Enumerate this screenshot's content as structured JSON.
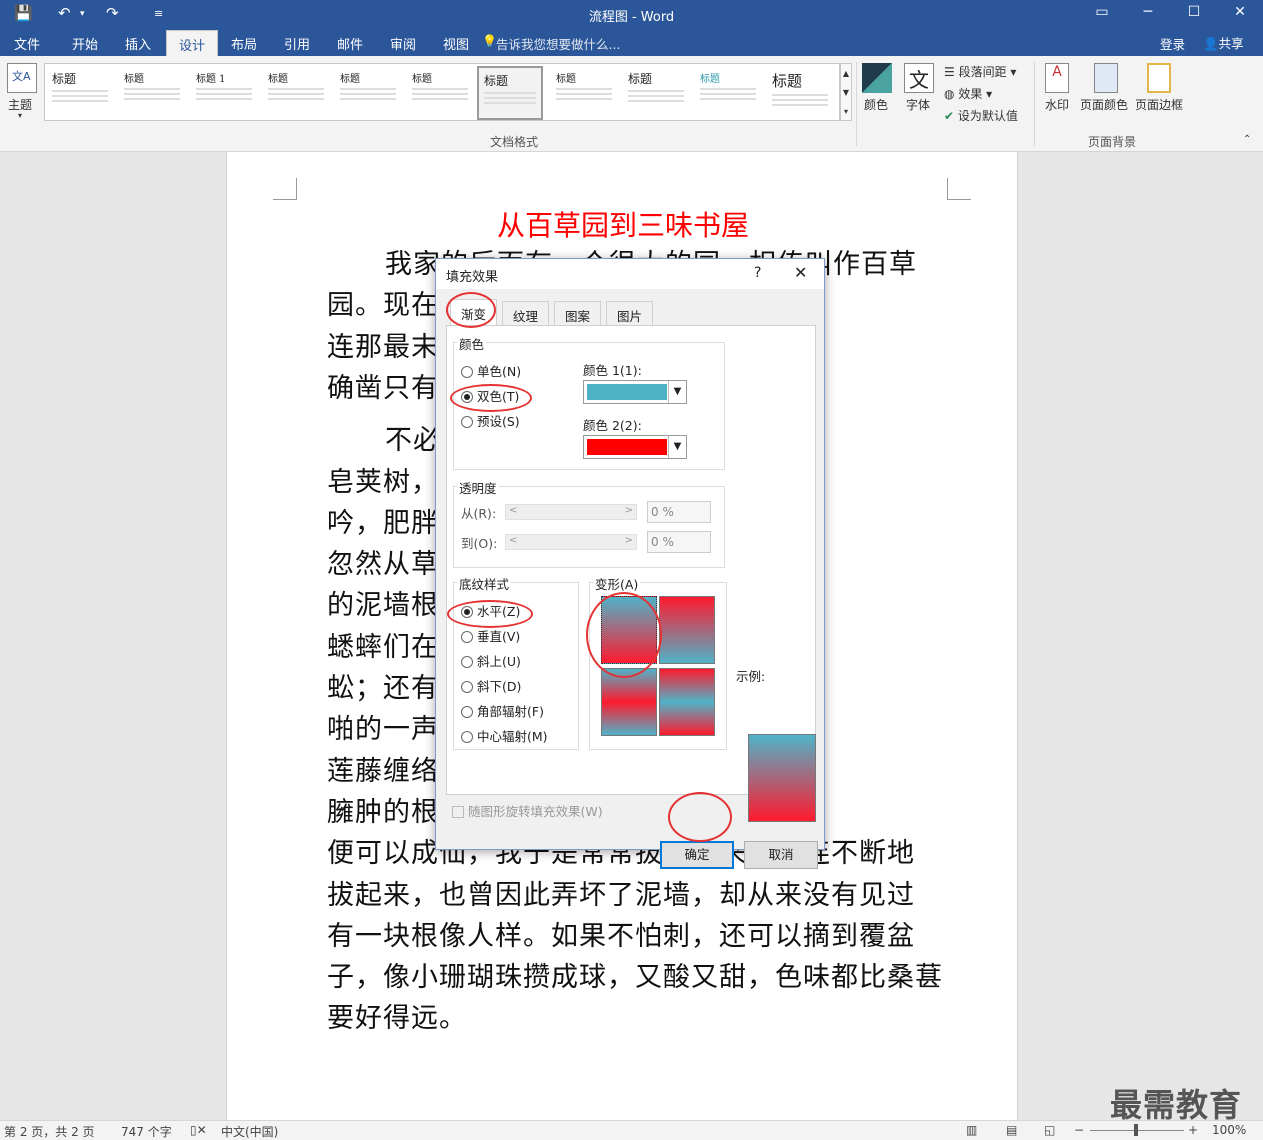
{
  "window": {
    "title": "流程图 - Word"
  },
  "ribbon_tabs": [
    "文件",
    "开始",
    "插入",
    "设计",
    "布局",
    "引用",
    "邮件",
    "审阅",
    "视图"
  ],
  "tell_me": "告诉我您想要做什么...",
  "login": "登录",
  "share": "共享",
  "ribbon": {
    "theme": "主题",
    "style_title": "标题",
    "style_heading": "标题 1",
    "group_doc_format": "文档格式",
    "colors": "颜色",
    "fonts": "字体",
    "paragraph_spacing": "段落间距",
    "effects": "效果",
    "set_default": "设为默认值",
    "watermark": "水印",
    "page_color": "页面颜色",
    "page_border": "页面边框",
    "group_page_bg": "页面背景"
  },
  "document": {
    "title": "从百草园到三味书屋",
    "lines": [
      "我家的后面有一个很大的园，相传叫作百草",
      "园。现在                                  的子孙了，",
      "连那最末                                  其中似乎",
      "确凿只有                                  园。",
      "不必                                  ，高大的",
      "皂荚树，                                  树叶里长",
      "吟，肥胖                                  子(云雀)",
      "忽然从草                                  围的短短",
      "的泥墙根                                  里低唱，",
      "蟋蟀们在                                  会遇见蜈",
      "蚣；还有                                  梁，便会",
      "啪的一声                                  乌藤和木",
      "莲藤缠络                                  何首乌有",
      "臃肿的根                                  形的，吃了",
      "便可以成仙，我于是常常拔它起来，牵连不断地",
      "拔起来，也曾因此弄坏了泥墙，却从来没有见过",
      "有一块根像人样。如果不怕刺，还可以摘到覆盆",
      "子，像小珊瑚珠攒成球，又酸又甜，色味都比桑葚",
      "要好得远。"
    ]
  },
  "status": {
    "page": "第 2 页，共 2 页",
    "words": "747 个字",
    "lang": "中文(中国)",
    "zoom": "100%"
  },
  "watermark": "最需教育",
  "dialog": {
    "title": "填充效果",
    "help": "?",
    "close": "✕",
    "tabs": [
      "渐变",
      "纹理",
      "图案",
      "图片"
    ],
    "colors_group": "颜色",
    "radio_one": "单色(N)",
    "radio_two": "双色(T)",
    "radio_preset": "预设(S)",
    "color1_label": "颜色 1(1):",
    "color2_label": "颜色 2(2):",
    "color1": "#4fb3c8",
    "color2": "#ff0000",
    "transparency_group": "透明度",
    "from_label": "从(R):",
    "to_label": "到(O):",
    "from_value": "0 %",
    "to_value": "0 %",
    "shading_group": "底纹样式",
    "shading": [
      "水平(Z)",
      "垂直(V)",
      "斜上(U)",
      "斜下(D)",
      "角部辐射(F)",
      "中心辐射(M)"
    ],
    "variants_label": "变形(A)",
    "sample_label": "示例:",
    "rotate_checkbox": "随图形旋转填充效果(W)",
    "ok": "确定",
    "cancel": "取消"
  }
}
